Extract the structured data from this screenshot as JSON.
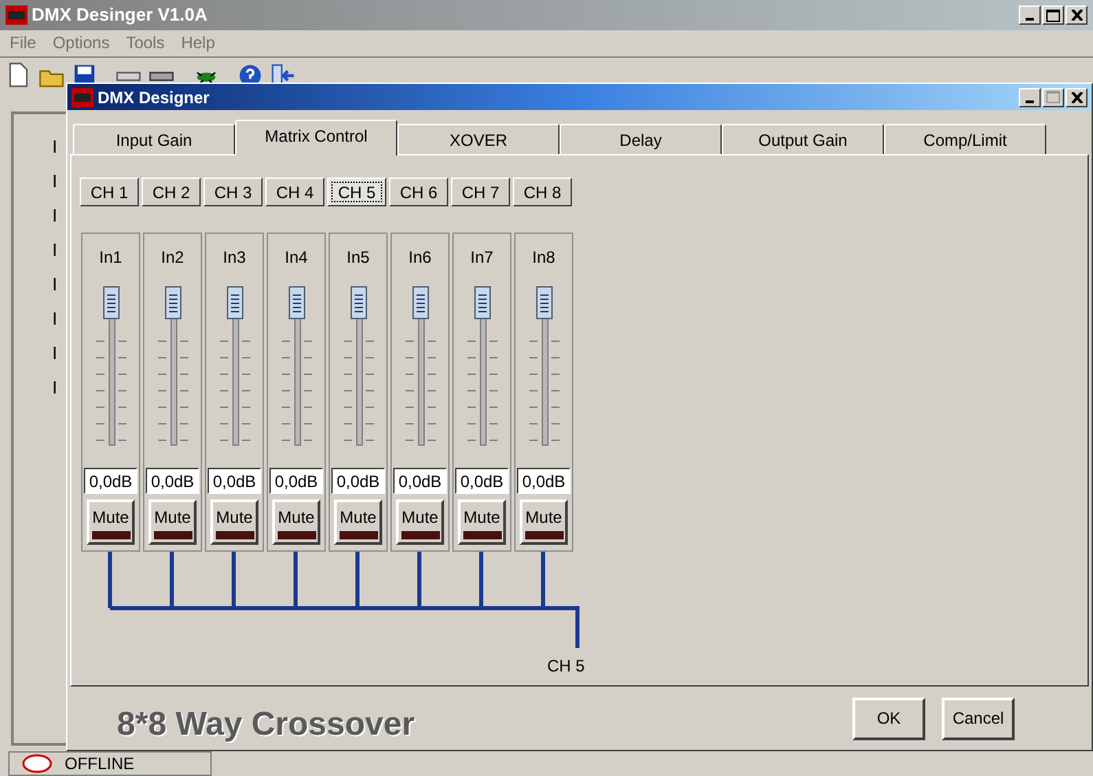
{
  "app_window": {
    "title": "DMX Desinger V1.0A",
    "menu": [
      "File",
      "Options",
      "Tools",
      "Help"
    ],
    "left_list": [
      "I",
      "I",
      "I",
      "I",
      "I",
      "I",
      "I",
      "I"
    ],
    "status": "OFFLINE"
  },
  "dialog": {
    "title": "DMX Designer",
    "tabs": [
      {
        "label": "Input Gain",
        "selected": false
      },
      {
        "label": "Matrix Control",
        "selected": true
      },
      {
        "label": "XOVER",
        "selected": false
      },
      {
        "label": "Delay",
        "selected": false
      },
      {
        "label": "Output Gain",
        "selected": false
      },
      {
        "label": "Comp/Limit",
        "selected": false
      }
    ],
    "channel_buttons": [
      {
        "label": "CH 1",
        "selected": false
      },
      {
        "label": "CH 2",
        "selected": false
      },
      {
        "label": "CH 3",
        "selected": false
      },
      {
        "label": "CH 4",
        "selected": false
      },
      {
        "label": "CH 5",
        "selected": true
      },
      {
        "label": "CH 6",
        "selected": false
      },
      {
        "label": "CH 7",
        "selected": false
      },
      {
        "label": "CH 8",
        "selected": false
      }
    ],
    "inputs": [
      {
        "name": "In1",
        "level": 1,
        "value": "0,0dB",
        "mute_label": "Mute",
        "muted": false
      },
      {
        "name": "In2",
        "level": 1,
        "value": "0,0dB",
        "mute_label": "Mute",
        "muted": false
      },
      {
        "name": "In3",
        "level": 1,
        "value": "0,0dB",
        "mute_label": "Mute",
        "muted": false
      },
      {
        "name": "In4",
        "level": 1,
        "value": "0,0dB",
        "mute_label": "Mute",
        "muted": false
      },
      {
        "name": "In5",
        "level": 1,
        "value": "0,0dB",
        "mute_label": "Mute",
        "muted": false
      },
      {
        "name": "In6",
        "level": 1,
        "value": "0,0dB",
        "mute_label": "Mute",
        "muted": false
      },
      {
        "name": "In7",
        "level": 1,
        "value": "0,0dB",
        "mute_label": "Mute",
        "muted": false
      },
      {
        "name": "In8",
        "level": 1,
        "value": "0,0dB",
        "mute_label": "Mute",
        "muted": false
      }
    ],
    "output_label": "CH 5",
    "caption": "8*8 Way Crossover",
    "buttons": [
      "OK",
      "Cancel"
    ]
  }
}
